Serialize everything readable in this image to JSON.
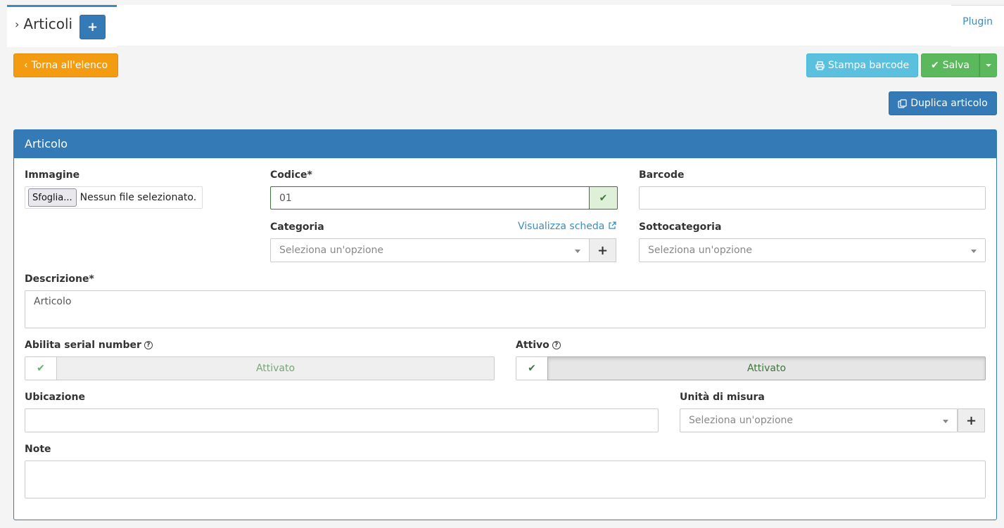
{
  "tabs": {
    "title": "Articoli",
    "add_label": "+",
    "plugin_label": "Plugin"
  },
  "toolbar": {
    "back_label": "Torna all'elenco",
    "barcode_label": "Stampa barcode",
    "save_label": "Salva",
    "duplicate_label": "Duplica articolo"
  },
  "panel": {
    "title": "Articolo"
  },
  "form": {
    "image_label": "Immagine",
    "file_button": "Sfoglia...",
    "file_status": "Nessun file selezionato.",
    "code_label": "Codice*",
    "code_value": "01",
    "barcode_label": "Barcode",
    "barcode_value": "",
    "category_label": "Categoria",
    "category_link": "Visualizza scheda",
    "category_placeholder": "Seleziona un'opzione",
    "subcategory_label": "Sottocategoria",
    "subcategory_placeholder": "Seleziona un'opzione",
    "description_label": "Descrizione*",
    "description_value": "Articolo",
    "serial_label": "Abilita serial number",
    "serial_state": "Attivato",
    "active_label": "Attivo",
    "active_state": "Attivato",
    "location_label": "Ubicazione",
    "location_value": "",
    "unit_label": "Unità di misura",
    "unit_placeholder": "Seleziona un'opzione",
    "notes_label": "Note",
    "notes_value": ""
  },
  "colors": {
    "primary": "#337ab7",
    "warning": "#f39c12",
    "info": "#5bc0de",
    "success": "#5cb85c",
    "valid_border": "#3c763d"
  }
}
